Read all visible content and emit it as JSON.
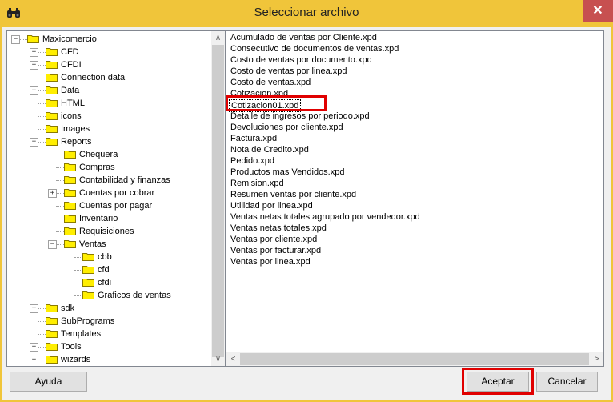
{
  "window": {
    "title": "Seleccionar archivo",
    "close_glyph": "✕"
  },
  "tree": {
    "items": [
      {
        "label": "Maxicomercio",
        "level": 0,
        "expander": "−"
      },
      {
        "label": "CFD",
        "level": 1,
        "expander": "+"
      },
      {
        "label": "CFDI",
        "level": 1,
        "expander": "+"
      },
      {
        "label": "Connection data",
        "level": 1,
        "expander": ""
      },
      {
        "label": "Data",
        "level": 1,
        "expander": "+"
      },
      {
        "label": "HTML",
        "level": 1,
        "expander": ""
      },
      {
        "label": "icons",
        "level": 1,
        "expander": ""
      },
      {
        "label": "Images",
        "level": 1,
        "expander": ""
      },
      {
        "label": "Reports",
        "level": 1,
        "expander": "−"
      },
      {
        "label": "Chequera",
        "level": 2,
        "expander": ""
      },
      {
        "label": "Compras",
        "level": 2,
        "expander": ""
      },
      {
        "label": "Contabilidad y finanzas",
        "level": 2,
        "expander": ""
      },
      {
        "label": "Cuentas por cobrar",
        "level": 2,
        "expander": "+"
      },
      {
        "label": "Cuentas por pagar",
        "level": 2,
        "expander": ""
      },
      {
        "label": "Inventario",
        "level": 2,
        "expander": ""
      },
      {
        "label": "Requisiciones",
        "level": 2,
        "expander": ""
      },
      {
        "label": "Ventas",
        "level": 2,
        "expander": "−"
      },
      {
        "label": "cbb",
        "level": 3,
        "expander": ""
      },
      {
        "label": "cfd",
        "level": 3,
        "expander": ""
      },
      {
        "label": "cfdi",
        "level": 3,
        "expander": ""
      },
      {
        "label": "Graficos de ventas",
        "level": 3,
        "expander": ""
      },
      {
        "label": "sdk",
        "level": 1,
        "expander": "+"
      },
      {
        "label": "SubPrograms",
        "level": 1,
        "expander": ""
      },
      {
        "label": "Templates",
        "level": 1,
        "expander": ""
      },
      {
        "label": "Tools",
        "level": 1,
        "expander": "+"
      },
      {
        "label": "wizards",
        "level": 1,
        "expander": "+"
      }
    ]
  },
  "files": {
    "items": [
      "Acumulado de ventas por Cliente.xpd",
      "Consecutivo de documentos de ventas.xpd",
      "Costo de ventas por documento.xpd",
      "Costo de ventas por linea.xpd",
      "Costo de ventas.xpd",
      "Cotizacion.xpd",
      "Cotizacion01.xpd",
      "Detalle de ingresos por periodo.xpd",
      "Devoluciones por cliente.xpd",
      "Factura.xpd",
      "Nota de Credito.xpd",
      "Pedido.xpd",
      "Productos mas Vendidos.xpd",
      "Remision.xpd",
      "Resumen ventas por cliente.xpd",
      "Utilidad por linea.xpd",
      "Ventas netas totales agrupado por vendedor.xpd",
      "Ventas netas totales.xpd",
      "Ventas por cliente.xpd",
      "Ventas por facturar.xpd",
      "Ventas por linea.xpd"
    ],
    "selected_index": 6
  },
  "buttons": {
    "help_label": "Ayuda",
    "accept_label": "Aceptar",
    "cancel_label": "Cancelar"
  },
  "colors": {
    "frame": "#f0c53a",
    "close": "#c75050",
    "highlight": "#e00000",
    "folder": "#ffee00"
  },
  "icons": {
    "app": "binoculars-icon",
    "folder": "folder-icon"
  }
}
